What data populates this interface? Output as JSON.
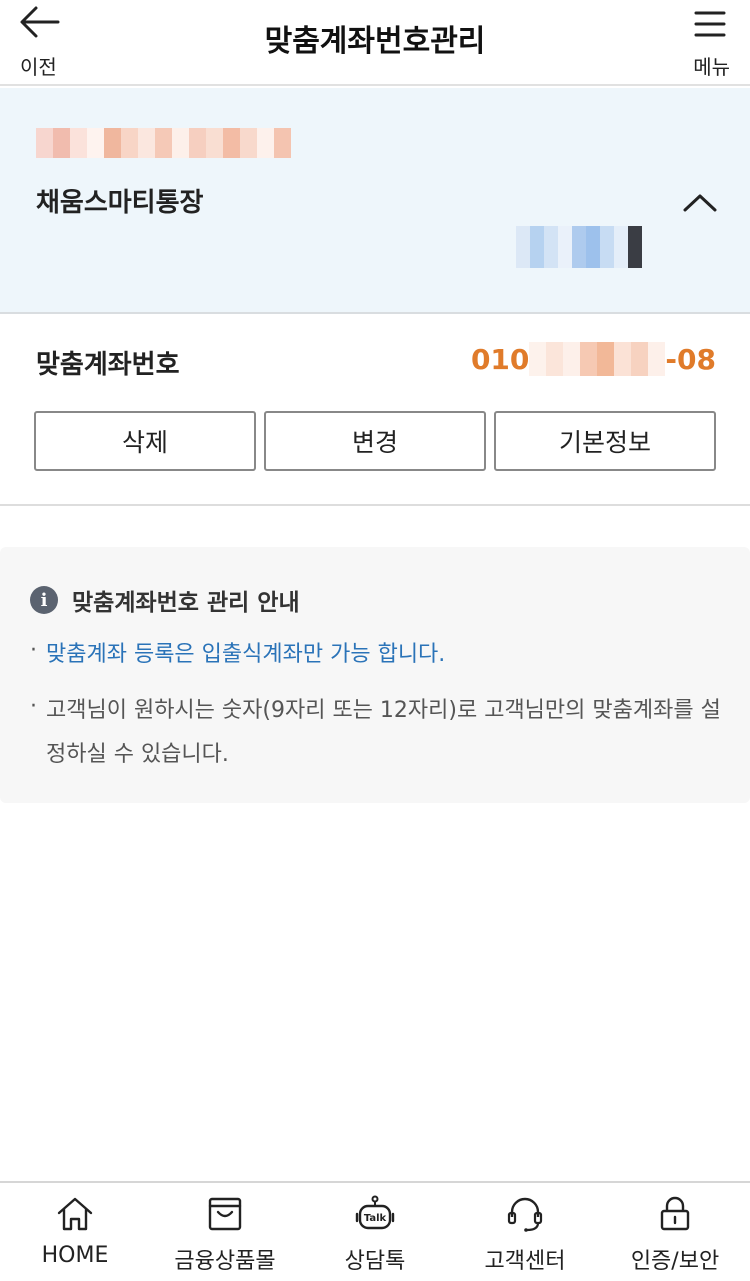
{
  "header": {
    "title": "맞춤계좌번호관리",
    "back_label": "이전",
    "menu_label": "메뉴"
  },
  "account": {
    "name": "채움스마티통장",
    "expanded": true
  },
  "custom_number": {
    "label": "맞춤계좌번호",
    "prefix": "010",
    "suffix": "-08"
  },
  "actions": {
    "delete_label": "삭제",
    "change_label": "변경",
    "info_label": "기본정보"
  },
  "notice": {
    "title": "맞춤계좌번호 관리 안내",
    "items": [
      "맞춤계좌 등록은 입출식계좌만 가능 합니다.",
      "고객님이 원하시는 숫자(9자리 또는 12자리)로 고객님만의 맞춤계좌를 설정하실 수 있습니다."
    ]
  },
  "bottom_nav": [
    {
      "label": "HOME",
      "icon": "home-icon"
    },
    {
      "label": "금융상품몰",
      "icon": "shopping-bag-icon"
    },
    {
      "label": "상담톡",
      "icon": "talk-robot-icon"
    },
    {
      "label": "고객센터",
      "icon": "headset-icon"
    },
    {
      "label": "인증/보안",
      "icon": "lock-icon"
    }
  ],
  "colors": {
    "accent_orange": "#e07b2a",
    "link_blue": "#2a73b8",
    "panel_bg": "#eef6fb",
    "info_bg": "#f7f7f7"
  }
}
